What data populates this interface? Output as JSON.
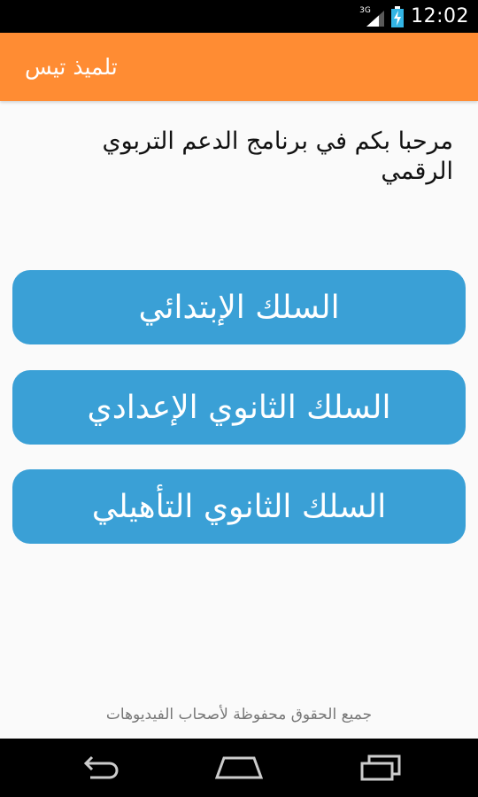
{
  "status_bar": {
    "network_type": "3G",
    "time": "12:02",
    "icons": [
      "signal-icon",
      "battery-charging-icon"
    ]
  },
  "app_bar": {
    "title": "تلميذ تيس",
    "color": "#ff8c33"
  },
  "welcome_text": "مرحبا بكم في برنامج الدعم التربوي الرقمي",
  "buttons": [
    {
      "label": "السلك الإبتدائي"
    },
    {
      "label": "السلك الثانوي الإعدادي"
    },
    {
      "label": "السلك الثانوي التأهيلي"
    }
  ],
  "button_color": "#3aa0d6",
  "footer_text": "جميع الحقوق محفوظة لأصحاب الفيديوهات",
  "nav_bar": {
    "icons": [
      "back-icon",
      "home-icon",
      "recent-apps-icon"
    ]
  }
}
